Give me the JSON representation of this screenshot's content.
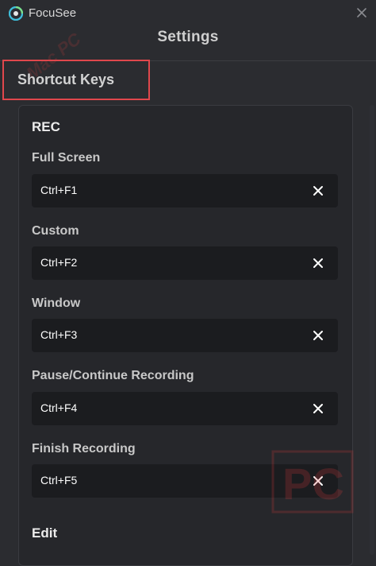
{
  "window": {
    "app_name": "FocuSee",
    "title": "Settings"
  },
  "section": {
    "heading": "Shortcut Keys"
  },
  "groups": [
    {
      "title": "REC",
      "items": [
        {
          "label": "Full Screen",
          "value": "Ctrl+F1"
        },
        {
          "label": "Custom",
          "value": "Ctrl+F2"
        },
        {
          "label": "Window",
          "value": "Ctrl+F3"
        },
        {
          "label": "Pause/Continue Recording",
          "value": "Ctrl+F4"
        },
        {
          "label": "Finish Recording",
          "value": "Ctrl+F5"
        }
      ]
    },
    {
      "title": "Edit",
      "items": []
    }
  ],
  "icons": {
    "app_logo": "focusee-logo-icon",
    "window_close": "close-icon",
    "clear": "x-icon"
  },
  "colors": {
    "background": "#2b2c30",
    "field_background": "#1b1c1f",
    "highlight_border": "#e0474c"
  },
  "watermark": {
    "text": "Mac PC",
    "logo_letters": "PC"
  }
}
